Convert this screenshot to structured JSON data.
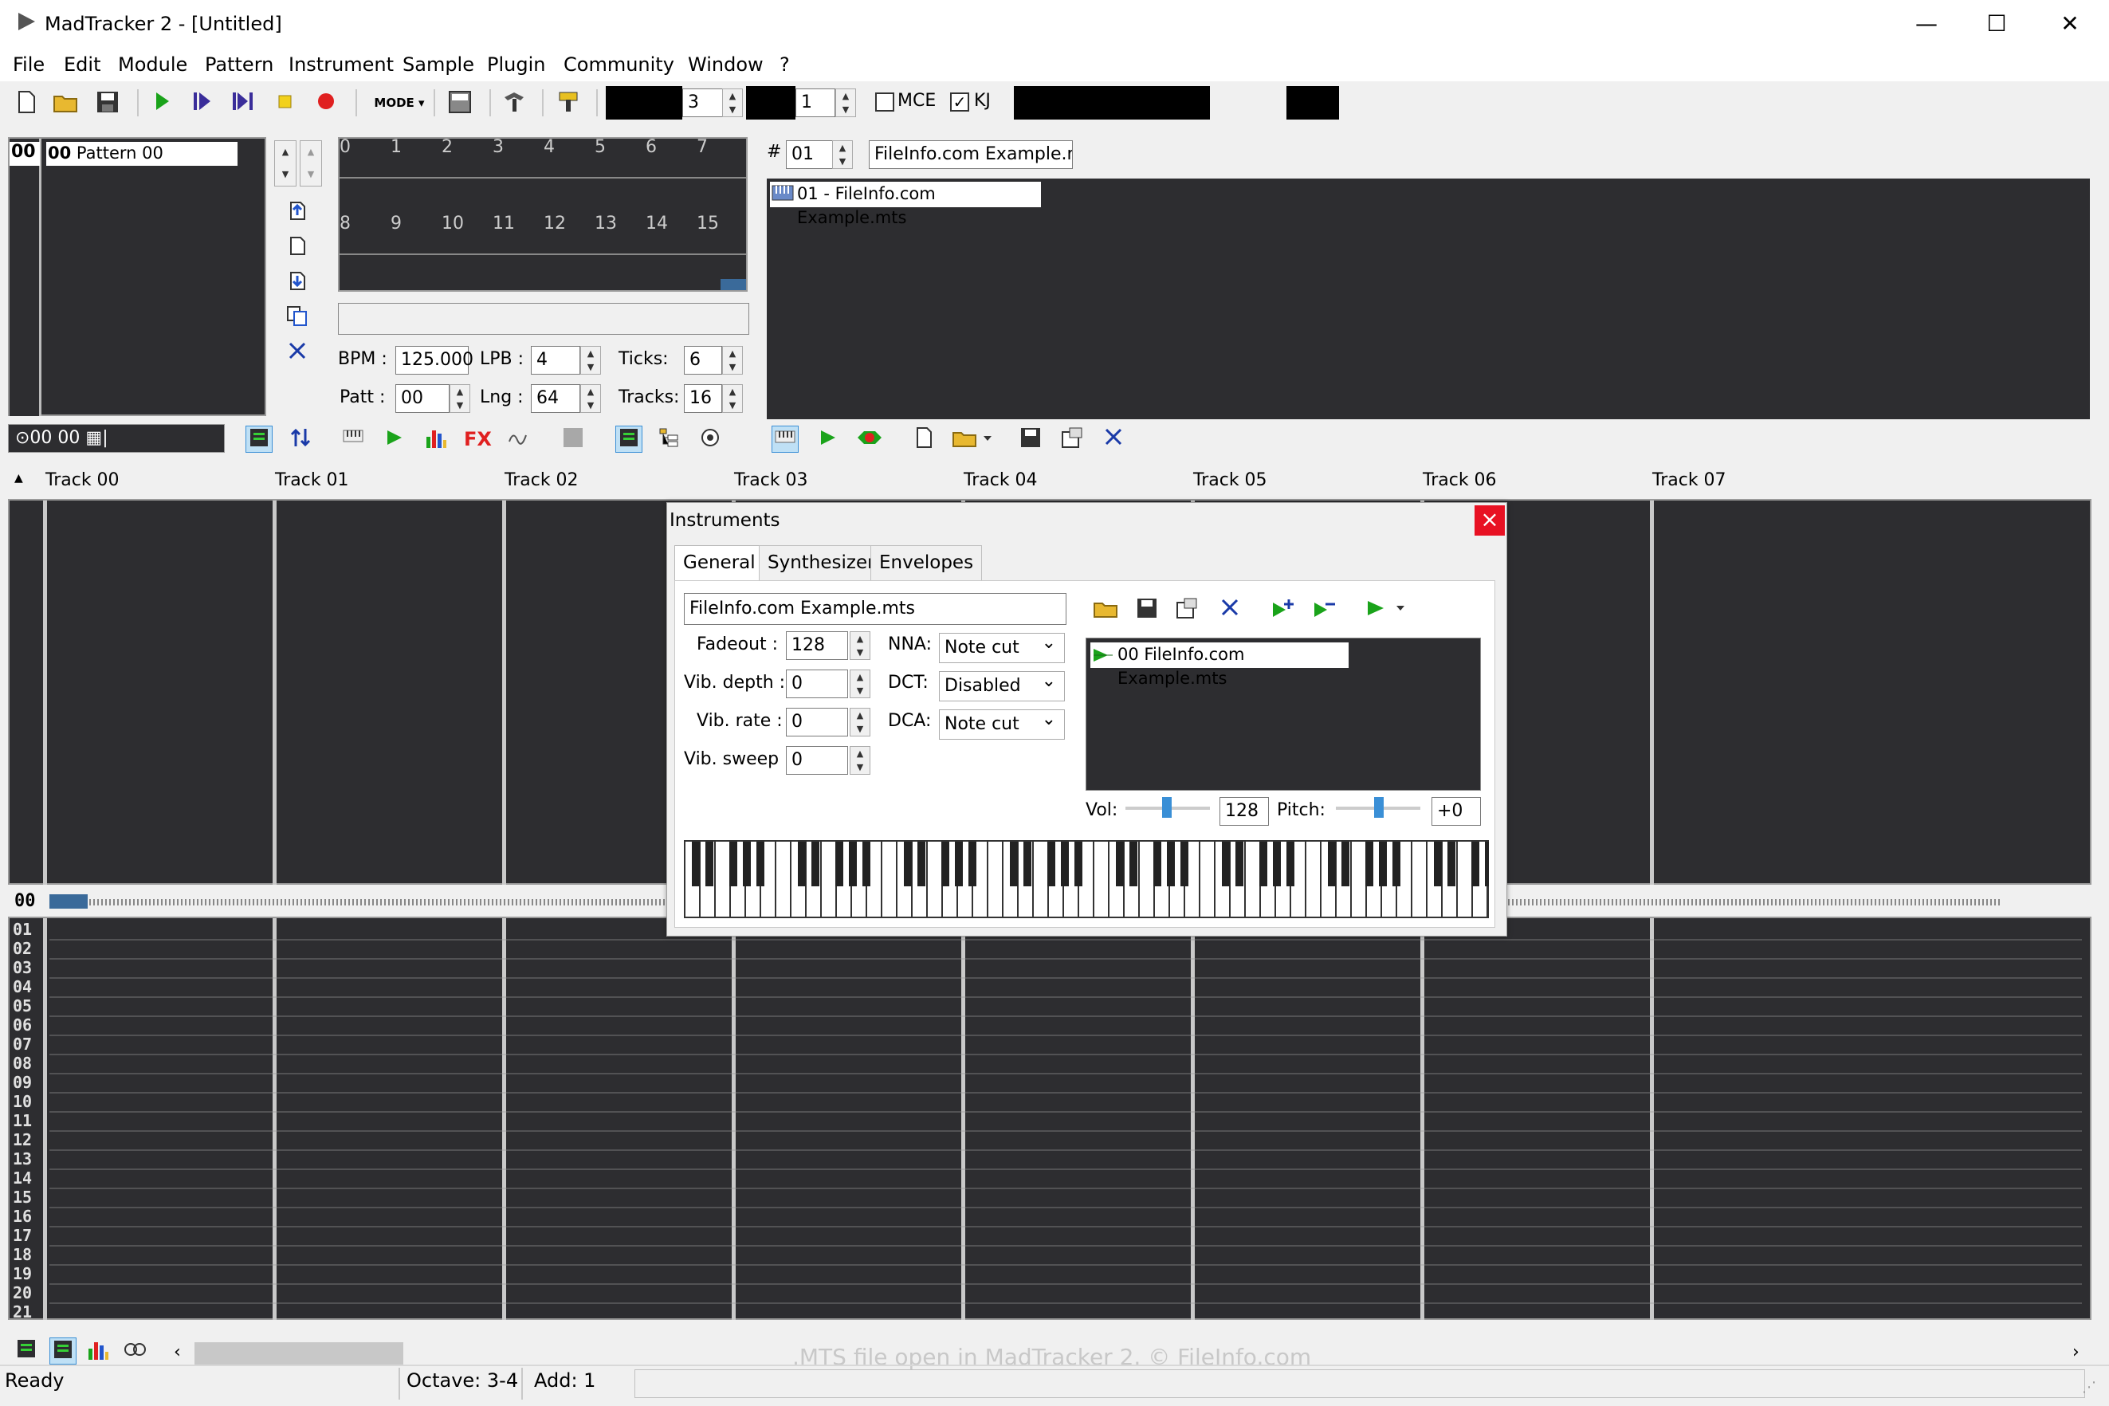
{
  "window": {
    "title": "MadTracker 2 - [Untitled]",
    "min": "—",
    "max": "☐",
    "close": "✕"
  },
  "menu": [
    "File",
    "Edit",
    "Module",
    "Pattern",
    "Instrument",
    "Sample",
    "Plugin",
    "Community",
    "Window",
    "?"
  ],
  "toolbar": {
    "octave_value": "3",
    "step_value": "1",
    "mce_label": "MCE",
    "kj_label": "KJ",
    "mode_label": "MODE",
    "mce_checked": false,
    "kj_checked": true
  },
  "patterns": {
    "index": "00",
    "row_index": "00",
    "row_name": "Pattern 00"
  },
  "order": {
    "row1": [
      "0",
      "1",
      "2",
      "3",
      "4",
      "5",
      "6",
      "7"
    ],
    "row2": [
      "8",
      "9",
      "10",
      "11",
      "12",
      "13",
      "14",
      "15"
    ]
  },
  "song": {
    "bpm_label": "BPM :",
    "bpm": "125.000",
    "lpb_label": "LPB :",
    "lpb": "4",
    "ticks_label": "Ticks:",
    "ticks": "6",
    "patt_label": "Patt :",
    "patt": "00",
    "lng_label": "Lng :",
    "lng": "64",
    "tracks_label": "Tracks:",
    "tracks": "16"
  },
  "instrument_list": {
    "hash": "#",
    "number": "01",
    "name": "FileInfo.com Example.mt",
    "item": "01 - FileInfo.com Example.mts"
  },
  "time_display": "⊙00 00 ▦|",
  "tracks": [
    "Track 00",
    "Track 01",
    "Track 02",
    "Track 03",
    "Track 04",
    "Track 05",
    "Track 06",
    "Track 07"
  ],
  "pattern_row_marker": "00",
  "rows": [
    "01",
    "02",
    "03",
    "04",
    "05",
    "06",
    "07",
    "08",
    "09",
    "10",
    "11",
    "12",
    "13",
    "14",
    "15",
    "16",
    "17",
    "18",
    "19",
    "20",
    "21"
  ],
  "dialog": {
    "title": "Instruments",
    "tabs": [
      "General",
      "Synthesizer",
      "Envelopes"
    ],
    "name": "FileInfo.com Example.mts",
    "fadeout_label": "Fadeout :",
    "fadeout": "128",
    "vibdepth_label": "Vib. depth :",
    "vibdepth": "0",
    "vibrate_label": "Vib. rate :",
    "vibrate": "0",
    "vibsweep_label": "Vib. sweep :",
    "vibsweep": "0",
    "nna_label": "NNA:",
    "nna": "Note cut",
    "dct_label": "DCT:",
    "dct": "Disabled",
    "dca_label": "DCA:",
    "dca": "Note cut",
    "sample_item": "00 FileInfo.com Example.mts",
    "vol_label": "Vol:",
    "vol": "128",
    "pitch_label": "Pitch:",
    "pitch": "+0",
    "close": "×"
  },
  "watermark": ".MTS file open in MadTracker 2. © FileInfo.com",
  "status": {
    "ready": "Ready",
    "octave": "Octave: 3-4",
    "add": "Add: 1"
  },
  "colors": {
    "dark_bg": "#2d2d30",
    "accent_blue": "#3a8fd6",
    "play_green": "#1aa31a",
    "record_red": "#e02020"
  }
}
